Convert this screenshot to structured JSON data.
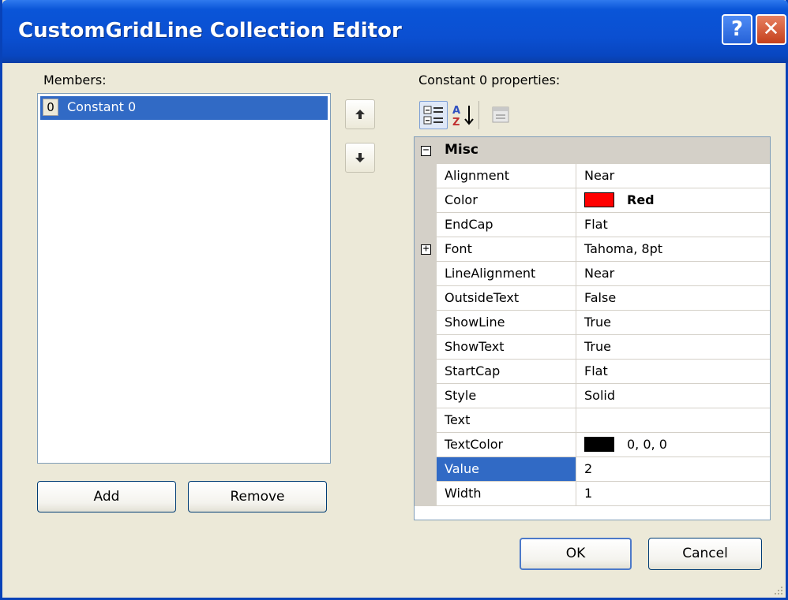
{
  "window": {
    "title": "CustomGridLine Collection Editor",
    "help_glyph": "?",
    "close_glyph": "✕"
  },
  "members": {
    "label": "Members:",
    "items": [
      {
        "index": "0",
        "label": "Constant 0",
        "selected": true
      }
    ],
    "add_label": "Add",
    "remove_label": "Remove"
  },
  "properties": {
    "label": "Constant 0 properties:",
    "category": "Misc",
    "rows": [
      {
        "name": "Alignment",
        "value": "Near"
      },
      {
        "name": "Color",
        "value": "Red",
        "swatch": "#ff0000",
        "bold": true
      },
      {
        "name": "EndCap",
        "value": "Flat"
      },
      {
        "name": "Font",
        "value": "Tahoma, 8pt",
        "expandable": true
      },
      {
        "name": "LineAlignment",
        "value": "Near"
      },
      {
        "name": "OutsideText",
        "value": "False"
      },
      {
        "name": "ShowLine",
        "value": "True"
      },
      {
        "name": "ShowText",
        "value": "True"
      },
      {
        "name": "StartCap",
        "value": "Flat"
      },
      {
        "name": "Style",
        "value": "Solid"
      },
      {
        "name": "Text",
        "value": ""
      },
      {
        "name": "TextColor",
        "value": "0, 0, 0",
        "swatch": "#000000"
      },
      {
        "name": "Value",
        "value": "2",
        "selected": true
      },
      {
        "name": "Width",
        "value": "1"
      }
    ]
  },
  "buttons": {
    "ok_label": "OK",
    "cancel_label": "Cancel"
  },
  "colors": {
    "title_blue": "#0b4fd1",
    "selection": "#316ac5",
    "dialog_bg": "#ece9d8"
  }
}
